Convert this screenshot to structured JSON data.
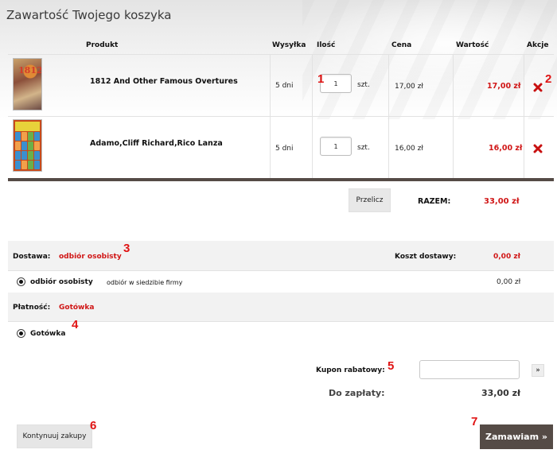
{
  "page": {
    "title": "Zawartość Twojego koszyka"
  },
  "table": {
    "headers": {
      "product": "Produkt",
      "shipping": "Wysyłka",
      "qty": "Ilość",
      "price": "Cena",
      "value": "Wartość",
      "actions": "Akcje"
    },
    "rows": [
      {
        "name": "1812 And Other Famous Overtures",
        "shipping": "5 dni",
        "qty": "1",
        "unit": "szt.",
        "price": "17,00 zł",
        "value": "17,00 zł",
        "thumb_text": "1812"
      },
      {
        "name": "Adamo,Cliff Richard,Rico Lanza",
        "shipping": "5 dni",
        "qty": "1",
        "unit": "szt.",
        "price": "16,00 zł",
        "value": "16,00 zł"
      }
    ]
  },
  "summary": {
    "recalc_label": "Przelicz",
    "total_label": "RAZEM:",
    "total_value": "33,00 zł"
  },
  "delivery": {
    "label": "Dostawa:",
    "selected": "odbiór osobisty",
    "cost_label": "Koszt dostawy:",
    "cost_value": "0,00 zł",
    "option_name": "odbiór osobisty",
    "option_desc": "odbiór w siedzibie firmy",
    "option_price": "0,00 zł"
  },
  "payment": {
    "label": "Płatność:",
    "selected": "Gotówka",
    "option_name": "Gotówka"
  },
  "coupon": {
    "label": "Kupon rabatowy:",
    "value": "",
    "go_label": "»"
  },
  "due": {
    "label": "Do zapłaty:",
    "value": "33,00 zł"
  },
  "actions": {
    "continue_label": "Kontynuuj zakupy",
    "order_label": "Zamawiam »"
  },
  "markers": {
    "m1": "1",
    "m2": "2",
    "m3": "3",
    "m4": "4",
    "m5": "5",
    "m6": "6",
    "m7": "7"
  },
  "colors": {
    "accent_red": "#d01616",
    "dark_brown": "#554b46",
    "strip_gray": "#f2f2f2"
  },
  "icons": {
    "delete": "delete-x-icon",
    "radio": "radio-selected-icon"
  }
}
